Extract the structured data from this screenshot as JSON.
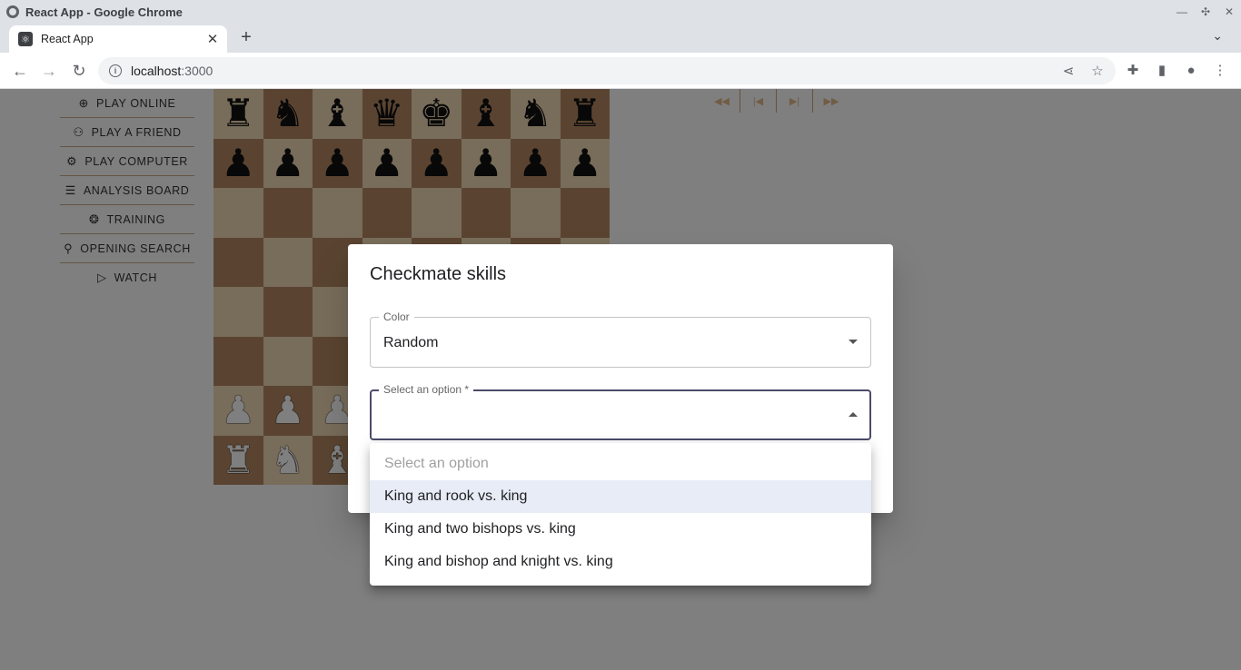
{
  "browser": {
    "window_title": "React App - Google Chrome",
    "tab_title": "React App",
    "url_host": "localhost",
    "url_port": ":3000"
  },
  "sidebar": {
    "items": [
      {
        "label": "PLAY ONLINE",
        "icon": "globe-icon"
      },
      {
        "label": "PLAY A FRIEND",
        "icon": "friends-icon"
      },
      {
        "label": "PLAY COMPUTER",
        "icon": "robot-icon"
      },
      {
        "label": "ANALYSIS BOARD",
        "icon": "sliders-icon"
      },
      {
        "label": "TRAINING",
        "icon": "brain-icon"
      },
      {
        "label": "OPENING SEARCH",
        "icon": "search-icon"
      },
      {
        "label": "WATCH",
        "icon": "video-icon"
      }
    ]
  },
  "board": {
    "rank8": [
      "♜",
      "♞",
      "♝",
      "♛",
      "♚",
      "♝",
      "♞",
      "♜"
    ],
    "rank7": [
      "♟",
      "♟",
      "♟",
      "♟",
      "♟",
      "♟",
      "♟",
      "♟"
    ],
    "rank2": [
      "♟",
      "♟",
      "♟",
      "♟",
      "♟",
      "♟",
      "♟",
      "♟"
    ],
    "rank1": [
      "♜",
      "♞",
      "♝",
      "♛",
      "♚",
      "♝",
      "♞",
      "♜"
    ]
  },
  "move_controls": [
    "first-move-icon",
    "prev-move-icon",
    "next-move-icon",
    "last-move-icon"
  ],
  "dialog": {
    "title": "Checkmate skills",
    "color_field": {
      "label": "Color",
      "value": "Random"
    },
    "option_field": {
      "label": "Select an option *",
      "value": ""
    },
    "menu": {
      "placeholder": "Select an option",
      "options": [
        "King and rook vs. king",
        "King and two bishops vs. king",
        "King and bishop and knight vs. king"
      ],
      "highlighted_index": 0
    }
  },
  "colors": {
    "light_square": "#f0d9b5",
    "dark_square": "#b58863",
    "backdrop": "rgba(0,0,0,0.5)"
  }
}
